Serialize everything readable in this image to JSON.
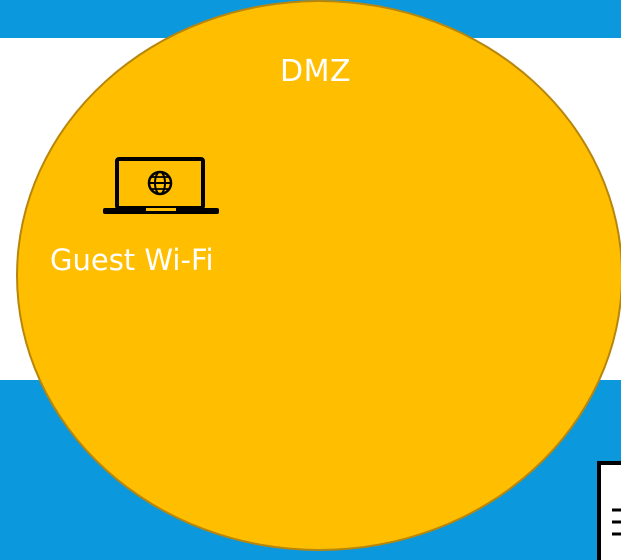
{
  "zone": {
    "label": "DMZ",
    "fill_color": "#ffbf00",
    "outline_color": "#b8860b"
  },
  "background_color": "#0b98dc",
  "nodes": [
    {
      "label": "Guest Wi-Fi",
      "icon": "laptop-globe-icon"
    }
  ],
  "partial_icons": [
    {
      "icon": "server-icon"
    }
  ]
}
